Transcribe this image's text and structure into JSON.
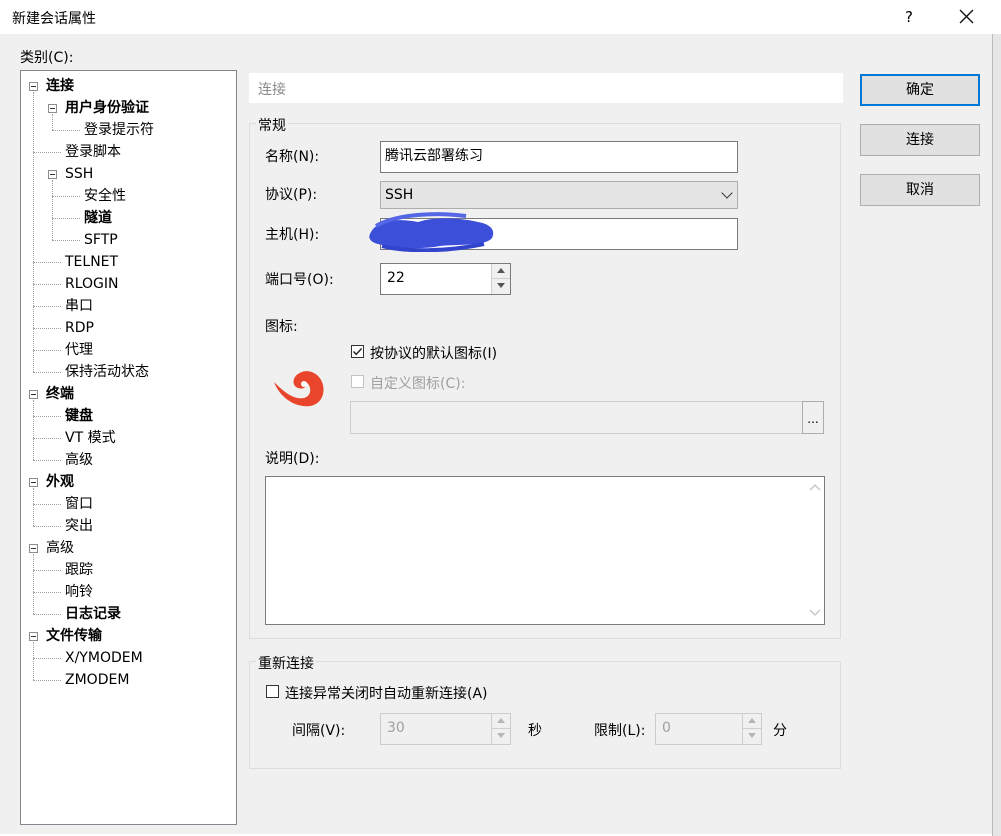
{
  "window": {
    "title": "新建会话属性",
    "help_glyph": "?"
  },
  "category_label": "类别(C):",
  "tree": [
    {
      "label": "连接",
      "bold": true
    },
    {
      "label": "用户身份验证",
      "bold": true
    },
    {
      "label": "登录提示符",
      "bold": false
    },
    {
      "label": "登录脚本",
      "bold": false
    },
    {
      "label": "SSH",
      "bold": false
    },
    {
      "label": "安全性",
      "bold": false
    },
    {
      "label": "隧道",
      "bold": true
    },
    {
      "label": "SFTP",
      "bold": false
    },
    {
      "label": "TELNET",
      "bold": false
    },
    {
      "label": "RLOGIN",
      "bold": false
    },
    {
      "label": "串口",
      "bold": false
    },
    {
      "label": "RDP",
      "bold": false
    },
    {
      "label": "代理",
      "bold": false
    },
    {
      "label": "保持活动状态",
      "bold": false
    },
    {
      "label": "终端",
      "bold": true
    },
    {
      "label": "键盘",
      "bold": true
    },
    {
      "label": "VT 模式",
      "bold": false
    },
    {
      "label": "高级",
      "bold": false
    },
    {
      "label": "外观",
      "bold": true
    },
    {
      "label": "窗口",
      "bold": false
    },
    {
      "label": "突出",
      "bold": false
    },
    {
      "label": "高级",
      "bold": false
    },
    {
      "label": "跟踪",
      "bold": false
    },
    {
      "label": "响铃",
      "bold": false
    },
    {
      "label": "日志记录",
      "bold": true
    },
    {
      "label": "文件传输",
      "bold": true
    },
    {
      "label": "X/YMODEM",
      "bold": false
    },
    {
      "label": "ZMODEM",
      "bold": false
    }
  ],
  "header": "连接",
  "general": {
    "title": "常规",
    "name_label": "名称(N):",
    "name_value": "腾讯云部署练习",
    "protocol_label": "协议(P):",
    "protocol_value": "SSH",
    "host_label": "主机(H):",
    "host_value": "",
    "port_label": "端口号(O):",
    "port_value": "22",
    "icon_label": "图标:",
    "default_icon_label": "按协议的默认图标(I)",
    "default_icon_checked": true,
    "custom_icon_label": "自定义图标(C):",
    "custom_icon_checked": false,
    "browse_label": "...",
    "description_label": "说明(D):",
    "description_value": ""
  },
  "reconnect": {
    "title": "重新连接",
    "checkbox_label": "连接异常关闭时自动重新连接(A)",
    "checked": false,
    "interval_label": "间隔(V):",
    "interval_value": "30",
    "seconds_unit": "秒",
    "limit_label": "限制(L):",
    "limit_value": "0",
    "minutes_unit": "分"
  },
  "buttons": {
    "ok": "确定",
    "connect": "连接",
    "cancel": "取消"
  },
  "colors": {
    "accent": "#0078d7",
    "dialog_bg": "#f0f0f0",
    "logo": "#e8452c",
    "redaction": "#3b4fd8"
  },
  "icons": [
    "close-icon",
    "help-icon",
    "minus-expander-icon",
    "session-logo-icon",
    "check-icon",
    "chevron-down-icon",
    "scroll-up-icon",
    "scroll-down-icon"
  ]
}
